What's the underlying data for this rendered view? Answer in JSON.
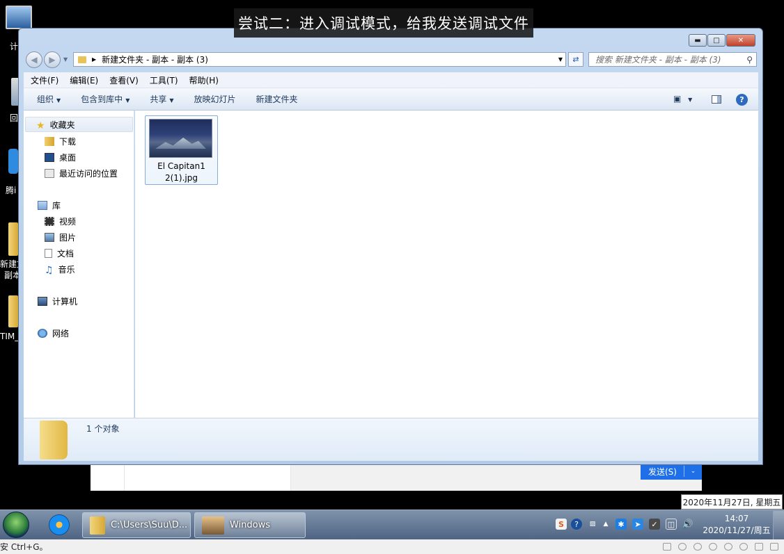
{
  "subtitle": "尝试二：进入调试模式，给我发送调试文件",
  "desktop_icons": [
    {
      "label": "计"
    },
    {
      "label": "回"
    },
    {
      "label": "腾i"
    },
    {
      "label": "新建文\n副本"
    },
    {
      "label": "TIM_"
    }
  ],
  "explorer": {
    "address_path": "新建文件夹 - 副本 - 副本 (3)",
    "search_placeholder": "搜索 新建文件夹 - 副本 - 副本 (3)",
    "menu": [
      "文件(F)",
      "编辑(E)",
      "查看(V)",
      "工具(T)",
      "帮助(H)"
    ],
    "commands": {
      "organize": "组织",
      "include_library": "包含到库中",
      "share": "共享",
      "slideshow": "放映幻灯片",
      "new_folder": "新建文件夹"
    },
    "nav": {
      "favorites": "收藏夹",
      "downloads": "下载",
      "desktop": "桌面",
      "recent": "最近访问的位置",
      "libraries": "库",
      "videos": "视频",
      "pictures": "图片",
      "documents": "文档",
      "music": "音乐",
      "computer": "计算机",
      "network": "网络"
    },
    "files": [
      {
        "name_line1": "El Capitan1",
        "name_line2": "2(1).jpg"
      }
    ],
    "details_count": "1 个对象"
  },
  "chat": {
    "send_label": "发送(S)"
  },
  "tooltip": "2020年11月27日, 星期五",
  "taskbar": {
    "explorer_task": "C:\\Users\\Suu\\D...",
    "windows_task": "Windows",
    "time": "14:07",
    "date": "2020/11/27/周五"
  },
  "bottom_hint": "安 Ctrl+G。",
  "colors": {
    "send_button": "#1e6fe8",
    "window_frame": "#b3cbe8",
    "close_button": "#c1412a"
  }
}
